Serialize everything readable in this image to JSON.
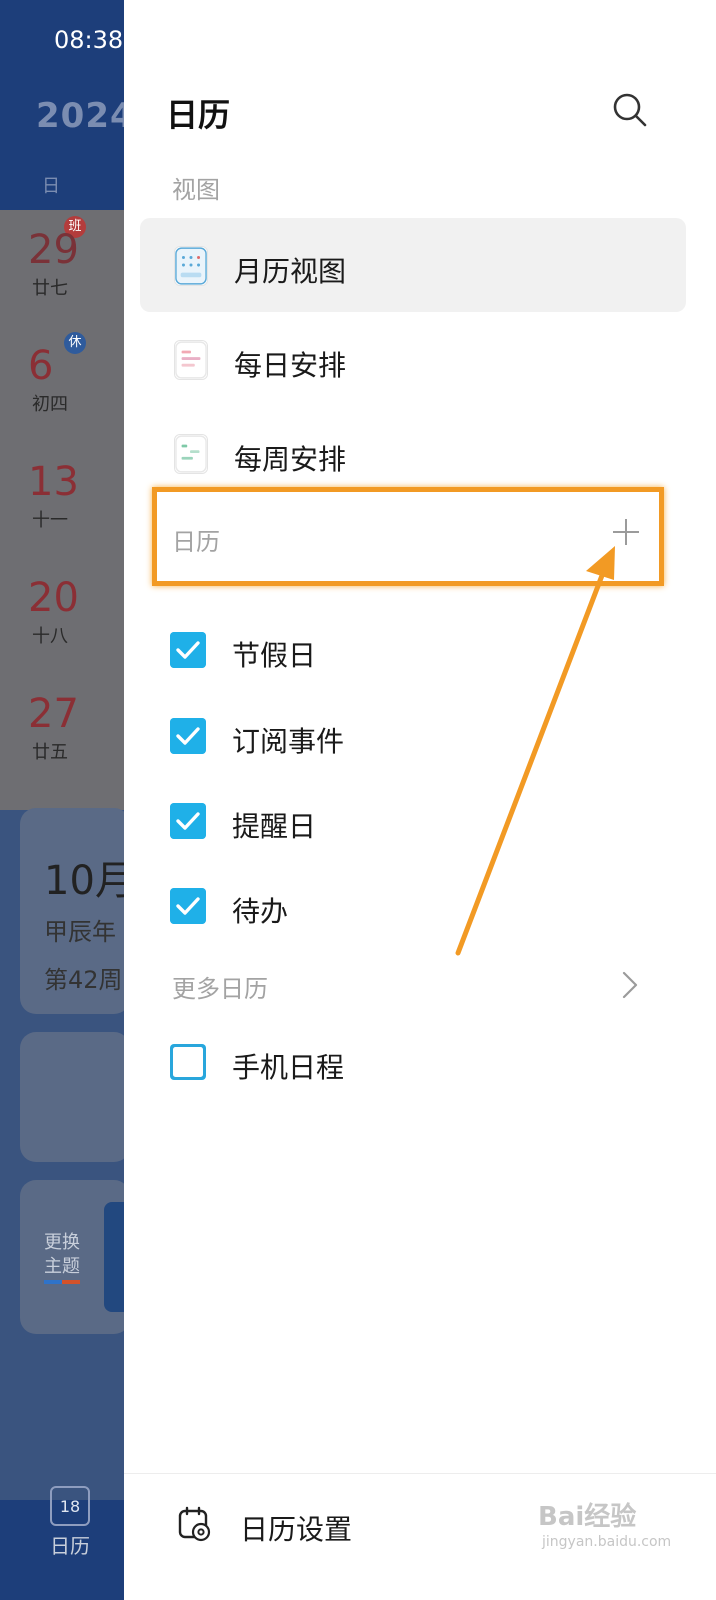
{
  "status_bar": {
    "time": "08:38"
  },
  "background": {
    "year_partial": "2024",
    "weekday_header": "日",
    "days": [
      {
        "num": "29",
        "lunar": "廿七",
        "badge": "班"
      },
      {
        "num": "6",
        "lunar": "初四",
        "badge": "休"
      },
      {
        "num": "13",
        "lunar": "十一"
      },
      {
        "num": "20",
        "lunar": "十八"
      },
      {
        "num": "27",
        "lunar": "廿五"
      }
    ],
    "card": {
      "month_partial": "10月",
      "sub1": "甲辰年",
      "sub2": "第42周"
    },
    "theme": {
      "line1": "更换",
      "line2": "主题"
    },
    "bottom_tab": {
      "icon_day": "18",
      "label": "日历"
    }
  },
  "drawer": {
    "title": "日历",
    "views_section": "视图",
    "views": [
      {
        "label": "月历视图",
        "active": true
      },
      {
        "label": "每日安排",
        "active": false
      },
      {
        "label": "每周安排",
        "active": false
      }
    ],
    "calendars_section": "日历",
    "calendars": [
      {
        "label": "节假日",
        "checked": true
      },
      {
        "label": "订阅事件",
        "checked": true
      },
      {
        "label": "提醒日",
        "checked": true
      },
      {
        "label": "待办",
        "checked": true
      }
    ],
    "more_section": "更多日历",
    "more_calendars": [
      {
        "label": "手机日程",
        "checked": false
      }
    ],
    "settings_label": "日历设置"
  },
  "annotation": {
    "highlight_color": "#f29a24"
  },
  "watermark": {
    "text": "Bai经验",
    "sub": "jingyan.baidu.com"
  },
  "colors": {
    "checkbox": "#1fb0e8",
    "header_bg": "#1d3e7a"
  }
}
